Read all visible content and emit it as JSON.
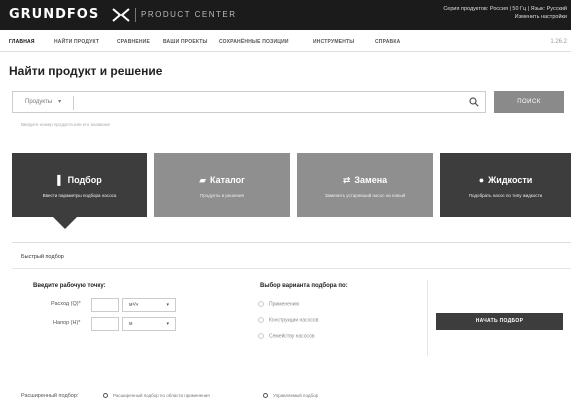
{
  "header": {
    "logo_text": "GRUNDFOS",
    "logo_mark_icon": "grundfos-x-icon",
    "product_center": "PRODUCT CENTER",
    "region_line1": "Серия продуктов: Россия | 50 Гц | Язык: Русский",
    "region_line2": "Изменить настройки"
  },
  "nav": {
    "items": [
      {
        "label": "ГЛАВНАЯ"
      },
      {
        "label": "НАЙТИ ПРОДУКТ"
      },
      {
        "label": "СРАВНЕНИЕ"
      },
      {
        "label": "ВАШИ ПРОЕКТЫ"
      },
      {
        "label": "СОХРАНЁННЫЕ ПОЗИЦИИ"
      },
      {
        "label": "ИНСТРУМЕНТЫ"
      },
      {
        "label": "СПРАВКА"
      }
    ],
    "version": "1.26.2"
  },
  "page": {
    "title": "Найти продукт и решение"
  },
  "search": {
    "dropdown_value": "Продукты",
    "button_label": "ПОИСК",
    "hint": "Введите номер продукта или его название",
    "icon": "search-icon"
  },
  "tiles": [
    {
      "title": "Подбор",
      "subtitle": "Ввести параметры подбора насоса",
      "icon": "selection-icon"
    },
    {
      "title": "Каталог",
      "subtitle": "Продукты и решения",
      "icon": "catalog-icon"
    },
    {
      "title": "Замена",
      "subtitle": "Заменить устаревший насос на новый",
      "icon": "replace-icon"
    },
    {
      "title": "Жидкости",
      "subtitle": "Подобрать насос по типу жидкости",
      "icon": "liquid-drop-icon"
    }
  ],
  "quick": {
    "label": "Быстрый подбор",
    "duty_point_label": "Введите рабочую точку:",
    "flow_label": "Расход (Q)*",
    "flow_unit": "м³/ч",
    "head_label": "Напор (H)*",
    "head_unit": "м",
    "variant_label": "Выбор варианта подбора по:",
    "options": [
      {
        "label": "Применению"
      },
      {
        "label": "Конструкции насосов"
      },
      {
        "label": "Семейству насосов"
      }
    ],
    "start_button": "НАЧАТЬ ПОДБОР"
  },
  "advanced": {
    "label": "Расширенный подбор:",
    "option1": "Расширенный подбор по области применения",
    "option2": "Управляемый подбор"
  },
  "colors": {
    "dark_tile": "#3d3d3d",
    "gray_tile": "#8f8f8f",
    "header_bg": "#1b1b1b"
  }
}
